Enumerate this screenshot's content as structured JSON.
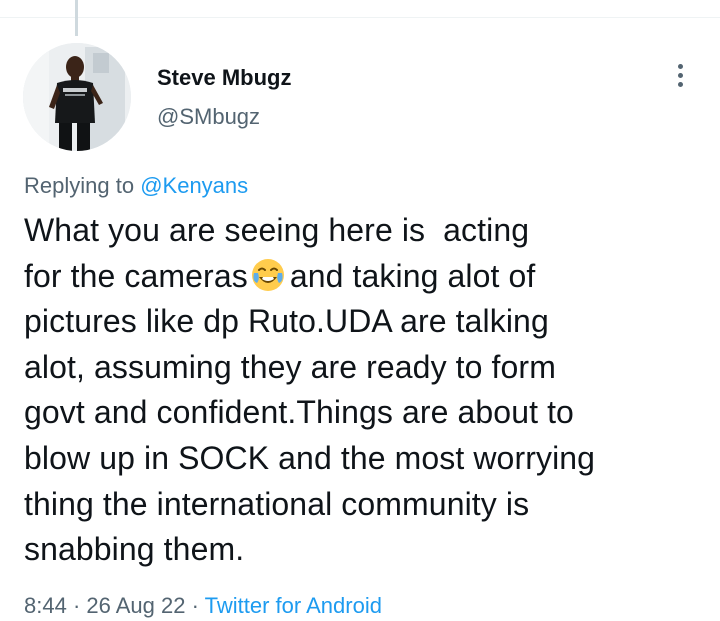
{
  "tweet": {
    "author": {
      "display_name": "Steve Mbugz",
      "handle": "@SMbugz"
    },
    "more_icon": "more-vertical-icon",
    "replying": {
      "prefix": "Replying to",
      "mention": "@Kenyans"
    },
    "text_lines": {
      "l1": "What you are seeing here is  acting",
      "l2a": "for the cameras",
      "l2_emoji": "face-with-tears-of-joy",
      "l2b": "and taking alot of",
      "l3": "pictures like dp Ruto.UDA are talking",
      "l4": "alot, assuming they are ready to form",
      "l5": "govt and confident.Things are about to",
      "l6": "blow up in SOCK and the most worrying",
      "l7": "thing the international community is",
      "l8": "snabbing them."
    },
    "meta": {
      "time": "8:44",
      "sep1": " · ",
      "date": "26 Aug 22",
      "sep2": " · ",
      "source": "Twitter for Android"
    }
  },
  "colors": {
    "text": "#0f1419",
    "secondary": "#536471",
    "link": "#1d9bf0",
    "divider": "#eff3f4"
  }
}
